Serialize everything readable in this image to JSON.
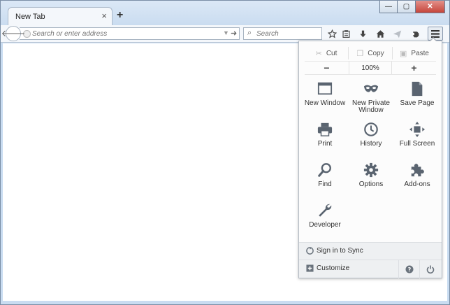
{
  "tab": {
    "title": "New Tab",
    "close_glyph": "×"
  },
  "newtab": {
    "glyph": "+"
  },
  "window_controls": {
    "minimize": "—",
    "maximize": "▢",
    "close": "✕"
  },
  "navbar": {
    "url_placeholder": "Search or enter address",
    "search_placeholder": "Search"
  },
  "menu": {
    "cut": "Cut",
    "copy": "Copy",
    "paste": "Paste",
    "zoom_out": "−",
    "zoom_level": "100%",
    "zoom_in": "+",
    "items": [
      {
        "label": "New Window",
        "icon": "new-window-icon"
      },
      {
        "label": "New Private Window",
        "icon": "mask-icon"
      },
      {
        "label": "Save Page",
        "icon": "document-icon"
      },
      {
        "label": "Print",
        "icon": "printer-icon"
      },
      {
        "label": "History",
        "icon": "clock-icon"
      },
      {
        "label": "Full Screen",
        "icon": "fullscreen-icon"
      },
      {
        "label": "Find",
        "icon": "magnifier-icon"
      },
      {
        "label": "Options",
        "icon": "gear-icon"
      },
      {
        "label": "Add-ons",
        "icon": "puzzle-icon"
      },
      {
        "label": "Developer",
        "icon": "wrench-icon"
      }
    ],
    "sync": "Sign in to Sync",
    "customize": "Customize"
  },
  "colors": {
    "frame": "#c9dcf1",
    "panel_bg": "#fcfcfc",
    "footer_bg": "#eef0f2",
    "icon_color": "#5a6470"
  }
}
